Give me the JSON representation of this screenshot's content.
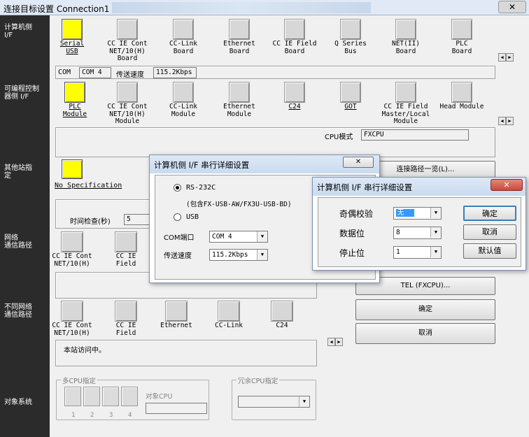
{
  "window": {
    "title": "连接目标设置 Connection1",
    "close": "✕"
  },
  "categories": {
    "pc_if": "计算机侧\nI/F",
    "plc_if": "可编程控制\n器侧 I/F",
    "other_station": "其他站指\n定",
    "network_route": "网络\n通信路径",
    "diff_network_route": "不同网络\n通信路径",
    "target_system": "对象系统"
  },
  "pc_if_items": [
    {
      "label": "Serial\nUSB",
      "underline": true,
      "selected": true
    },
    {
      "label": "CC IE Cont\nNET/10(H)\nBoard"
    },
    {
      "label": "CC-Link\nBoard"
    },
    {
      "label": "Ethernet\nBoard"
    },
    {
      "label": "CC IE Field\nBoard"
    },
    {
      "label": "Q Series\nBus"
    },
    {
      "label": "NET(II)\nBoard"
    },
    {
      "label": "PLC\nBoard"
    }
  ],
  "pc_info": {
    "com_label": "COM",
    "com_value": "COM 4",
    "speed_label": "传送速度",
    "speed_value": "115.2Kbps"
  },
  "plc_if_items": [
    {
      "label": "PLC\nModule",
      "underline": true,
      "selected": true
    },
    {
      "label": "CC IE Cont\nNET/10(H)\nModule"
    },
    {
      "label": "CC-Link\nModule"
    },
    {
      "label": "Ethernet\nModule"
    },
    {
      "label": "C24",
      "underline": true
    },
    {
      "label": "GOT",
      "underline": true
    },
    {
      "label": "CC IE Field\nMaster/Local\nModule"
    },
    {
      "label": "Head Module"
    }
  ],
  "cpu_mode": {
    "label": "CPU模式",
    "value": "FXCPU"
  },
  "other_station": {
    "label": "No Specification",
    "timeout_label": "时间检查(秒)",
    "timeout_value": "5"
  },
  "network_items": [
    {
      "label": "CC IE Cont\nNET/10(H)"
    },
    {
      "label": "CC IE\nField"
    }
  ],
  "diff_network_items": [
    {
      "label": "CC IE Cont\nNET/10(H)"
    },
    {
      "label": "CC IE\nField"
    },
    {
      "label": "Ethernet"
    },
    {
      "label": "CC-Link"
    },
    {
      "label": "C24"
    }
  ],
  "status_text": "本站访问中。",
  "right_buttons": {
    "route_list": "连接路径一览(L)...",
    "tel": "TEL (FXCPU)...",
    "ok": "确定",
    "cancel": "取消"
  },
  "multi_cpu": {
    "caption": "多CPU指定",
    "target_cpu": "对象CPU",
    "nums": [
      "1",
      "2",
      "3",
      "4"
    ]
  },
  "redundant_cpu": {
    "caption": "冗余CPU指定"
  },
  "serial_dialog": {
    "title": "计算机侧 I/F 串行详细设置",
    "rs232c": "RS-232C",
    "rs232c_note": "(包含FX-USB-AW/FX3U-USB-BD)",
    "usb": "USB",
    "com_label": "COM端口",
    "com_value": "COM 4",
    "speed_label": "传送速度",
    "speed_value": "115.2Kbps"
  },
  "detail_dialog": {
    "title": "计算机侧 I/F 串行详细设置",
    "parity_label": "奇偶校验",
    "parity_value": "无",
    "databits_label": "数据位",
    "databits_value": "8",
    "stopbits_label": "停止位",
    "stopbits_value": "1",
    "ok": "确定",
    "cancel": "取消",
    "default": "默认值"
  },
  "colors": {
    "accent_selected": "#ffff00",
    "left_bar": "#2b2b2b",
    "dialog_title": "#c9dbf0",
    "close_red": "#c94a3c"
  }
}
